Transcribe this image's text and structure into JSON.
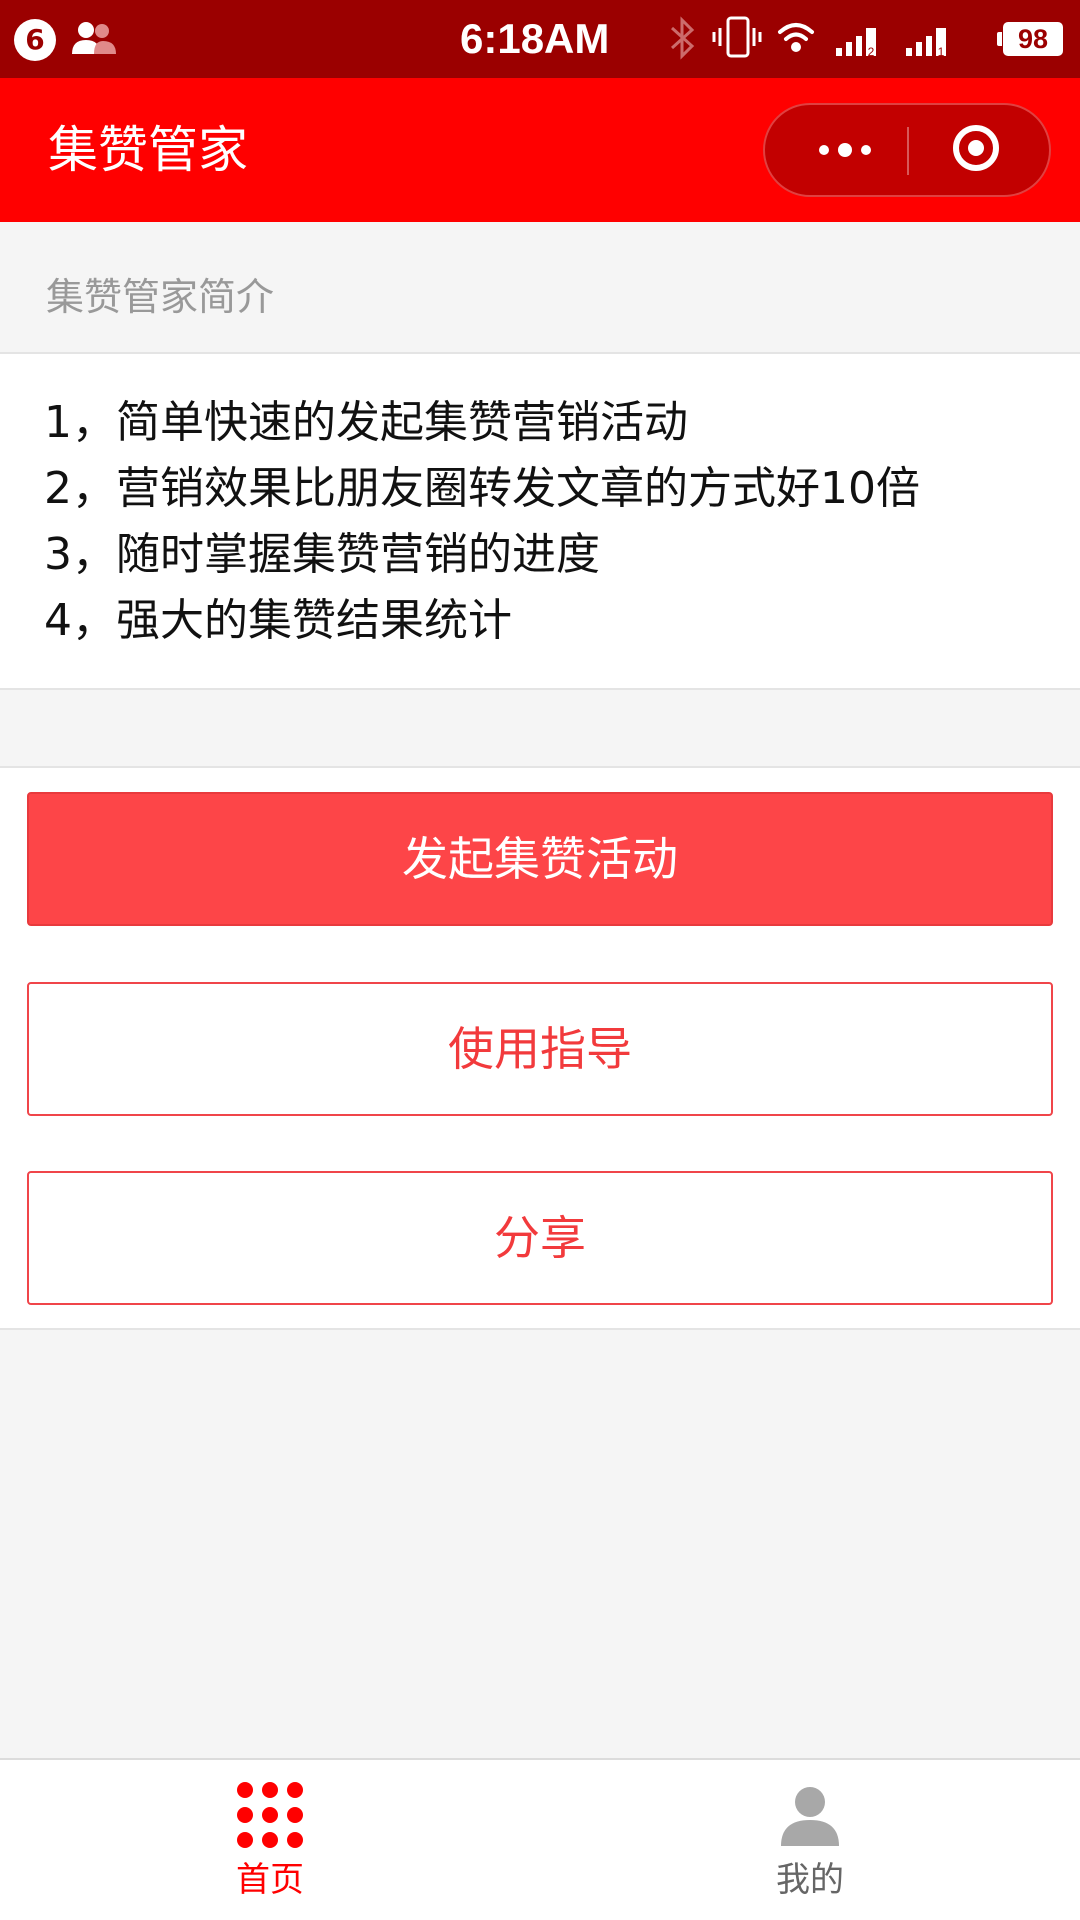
{
  "status_bar": {
    "notification_count": "6",
    "time": "6:18AM",
    "battery": "98",
    "sim2_label": "2",
    "sim1_label": "1"
  },
  "nav": {
    "title": "集赞管家"
  },
  "intro": {
    "header": "集赞管家简介",
    "items": [
      "1，简单快速的发起集赞营销活动",
      "2，营销效果比朋友圈转发文章的方式好10倍",
      "3，随时掌握集赞营销的进度",
      "4，强大的集赞结果统计"
    ]
  },
  "actions": {
    "start_label": "发起集赞活动",
    "guide_label": "使用指导",
    "share_label": "分享"
  },
  "tabbar": {
    "home_label": "首页",
    "mine_label": "我的",
    "active": "home"
  },
  "colors": {
    "status_bar": "#9b0000",
    "nav_bar": "#ff0000",
    "primary_button": "#fd4548",
    "accent_text": "#f23a3c",
    "active_tab": "#ff0000",
    "inactive_tab": "#666666"
  },
  "icons": {
    "status": [
      "contacts-icon",
      "bluetooth-icon",
      "vibrate-icon",
      "wifi-icon",
      "signal-icon",
      "battery-icon"
    ],
    "capsule": [
      "more-dots-icon",
      "close-target-icon"
    ],
    "tabs": [
      "grid-dots-icon",
      "person-icon"
    ]
  }
}
